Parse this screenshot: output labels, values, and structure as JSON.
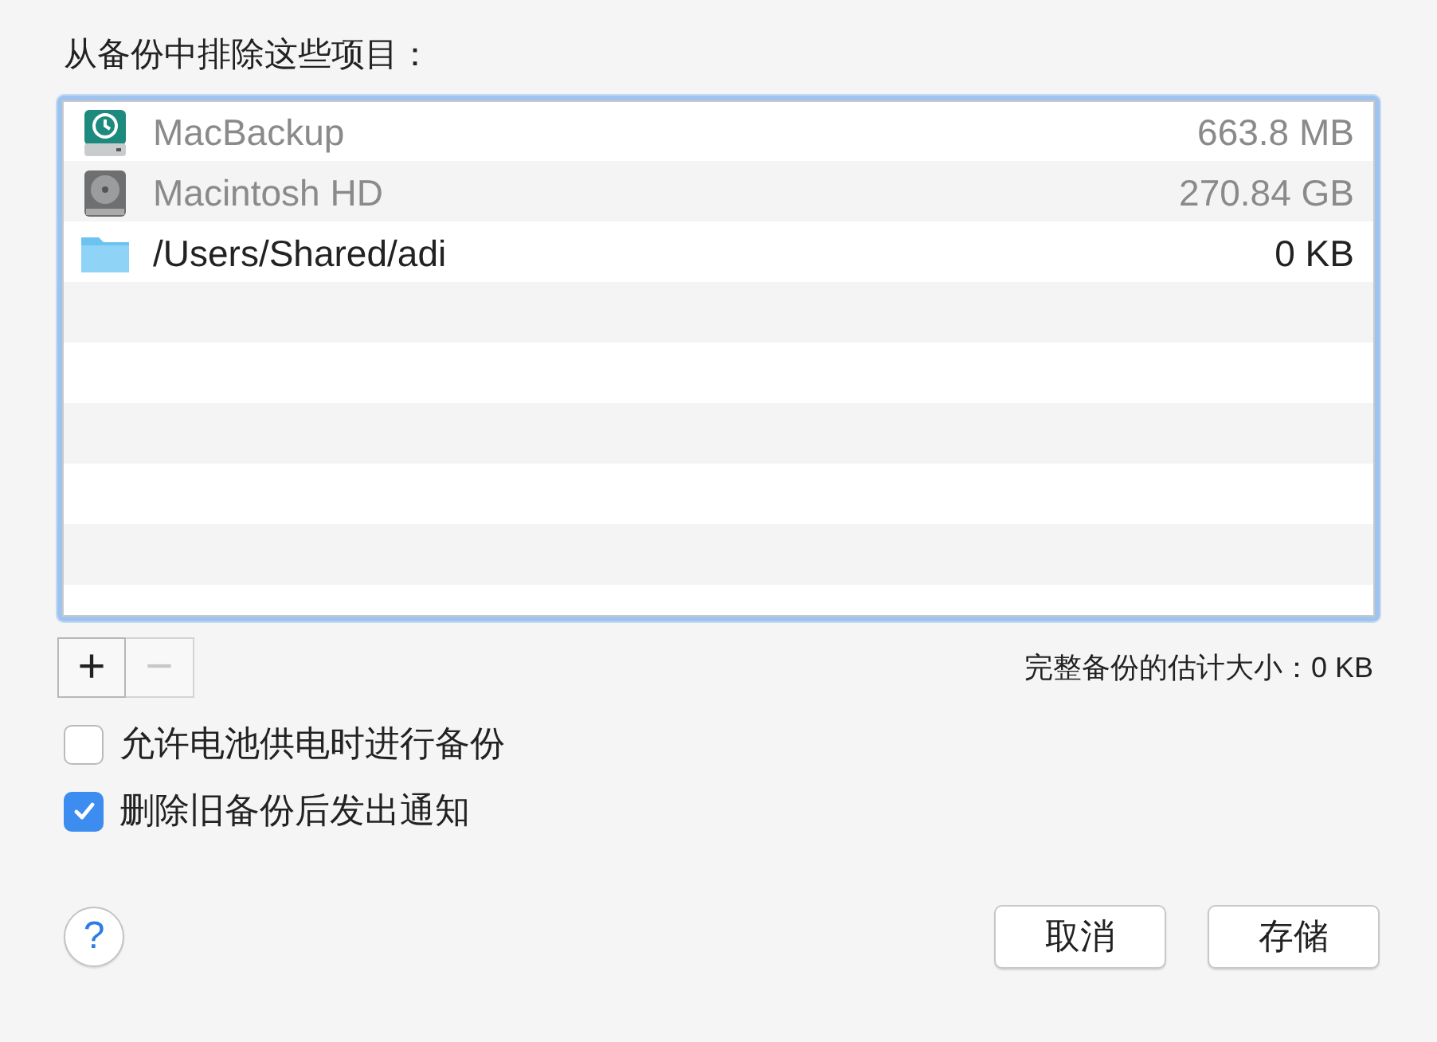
{
  "title": "从备份中排除这些项目：",
  "items": [
    {
      "kind": "backup-disk",
      "name": "MacBackup",
      "size": "663.8 MB",
      "dimmed": true
    },
    {
      "kind": "hard-disk",
      "name": "Macintosh HD",
      "size": "270.84 GB",
      "dimmed": true
    },
    {
      "kind": "folder",
      "name": "/Users/Shared/adi",
      "size": "0 KB",
      "dimmed": false
    }
  ],
  "add_button": {
    "label": "+",
    "disabled": false
  },
  "remove_button": {
    "label": "−",
    "disabled": true
  },
  "estimate": "完整备份的估计大小：0 KB",
  "options": [
    {
      "label": "允许电池供电时进行备份",
      "checked": false
    },
    {
      "label": "删除旧备份后发出通知",
      "checked": true
    }
  ],
  "help_button": "?",
  "buttons": [
    "取消",
    "存储"
  ]
}
